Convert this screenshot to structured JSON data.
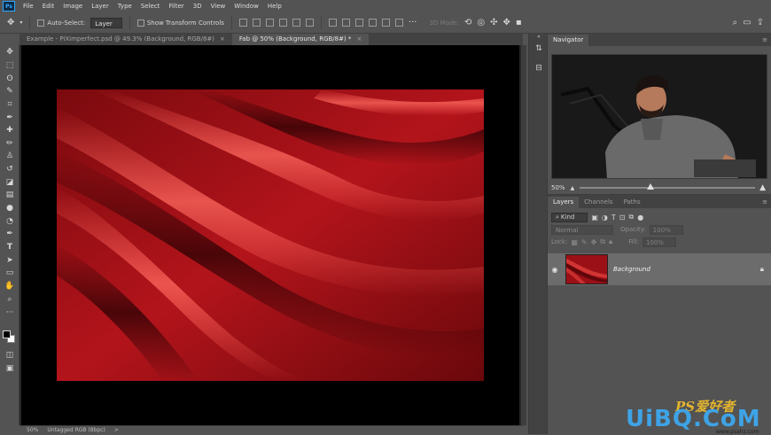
{
  "app": {
    "logo": "Ps"
  },
  "menu": [
    "File",
    "Edit",
    "Image",
    "Layer",
    "Type",
    "Select",
    "Filter",
    "3D",
    "View",
    "Window",
    "Help"
  ],
  "options_bar": {
    "auto_select_label": "Auto-Select:",
    "auto_select_value": "Layer",
    "transform_label": "Show Transform Controls",
    "mode_3d": "3D Mode:"
  },
  "tabs": [
    {
      "label": "Example - PiXimperfect.psd @ 49.3% (Background, RGB/8#)"
    },
    {
      "label": "Fab @ 50% (Background, RGB/8#) *"
    }
  ],
  "tab_close": "×",
  "status": {
    "zoom": "50%",
    "profile": "Untagged RGB (8bpc)",
    "arrow": ">"
  },
  "navigator": {
    "title": "Navigator",
    "zoom": "50%"
  },
  "layers_panel": {
    "tabs": [
      "Layers",
      "Channels",
      "Paths"
    ],
    "filter_kind": "Kind",
    "blend_mode": "Normal",
    "opacity_label": "Opacity:",
    "opacity_value": "100%",
    "lock_label": "Lock:",
    "fill_label": "Fill:",
    "fill_value": "100%",
    "layer_name": "Background"
  },
  "watermark": {
    "small": "PS爱好者",
    "big": "UiBQ.CoM",
    "sub": "www.psahz.com"
  },
  "colors": {
    "accent": "#31a8ff",
    "fabric": "#b3141b",
    "watermark_blue": "#3ea3e6",
    "watermark_gold": "#e2b330"
  }
}
